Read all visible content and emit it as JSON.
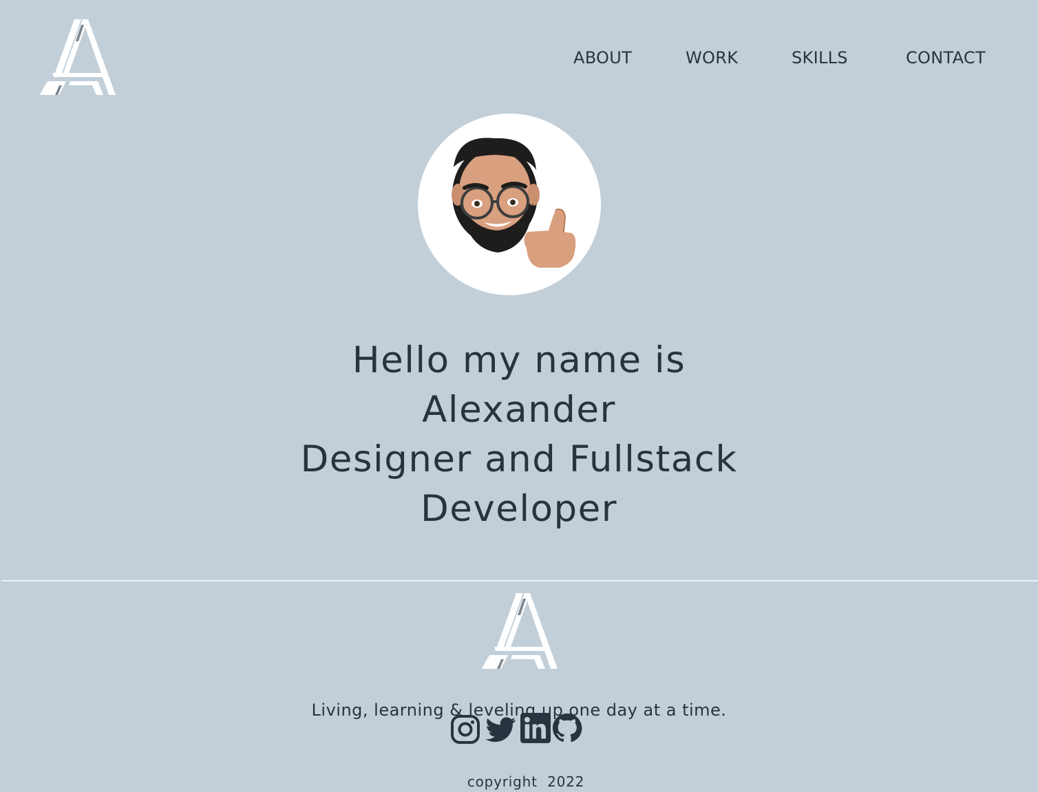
{
  "colors": {
    "background": "#c2cfd9",
    "text": "#27343f",
    "logo": "#ffffff",
    "logo_accent": "#7d8892",
    "divider": "#eef2f5"
  },
  "header": {
    "logo_icon": "letter-a-logo",
    "nav": [
      {
        "label": "ABOUT"
      },
      {
        "label": "WORK"
      },
      {
        "label": "SKILLS"
      },
      {
        "label": "CONTACT"
      }
    ]
  },
  "hero": {
    "avatar_icon": "memoji-thumbs-up-avatar",
    "title_lines": [
      "Hello my name is",
      "Alexander",
      "Designer and Fullstack",
      "Developer"
    ]
  },
  "footer": {
    "logo_icon": "letter-a-logo",
    "tagline": "Living, learning & leveling up one day at a time.",
    "socials": [
      {
        "icon": "instagram-icon"
      },
      {
        "icon": "twitter-icon"
      },
      {
        "icon": "linkedin-icon"
      },
      {
        "icon": "github-icon"
      }
    ],
    "copyright": "copyright  2022"
  }
}
